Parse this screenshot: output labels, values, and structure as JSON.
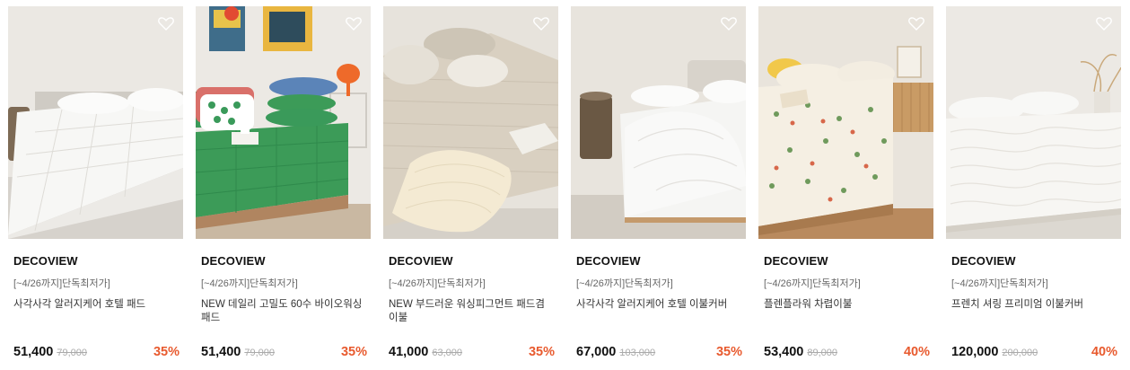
{
  "products": [
    {
      "brand": "DECOVIEW",
      "promo": "[~4/26까지]단독최저가]",
      "name": "사각사각 알러지케어 호텔 패드",
      "price": "51,400",
      "original_price": "79,000",
      "discount": "35%",
      "image": "white quilted mattress pad on bed"
    },
    {
      "brand": "DECOVIEW",
      "promo": "[~4/26까지]단독최저가]",
      "name": "NEW 데일리 고밀도 60수 바이오워싱 패드",
      "price": "51,400",
      "original_price": "79,000",
      "discount": "35%",
      "image": "green quilted pad with pillows and lamp"
    },
    {
      "brand": "DECOVIEW",
      "promo": "[~4/26까지]단독최저가]",
      "name": "NEW 부드러운 워싱피그먼트 패드겸 이불",
      "price": "41,000",
      "original_price": "63,000",
      "discount": "35%",
      "image": "beige quilted pad with knit blanket"
    },
    {
      "brand": "DECOVIEW",
      "promo": "[~4/26까지]단독최저가]",
      "name": "사각사각 알러지케어 호텔 이불커버",
      "price": "67,000",
      "original_price": "103,000",
      "discount": "35%",
      "image": "white duvet cover on bed"
    },
    {
      "brand": "DECOVIEW",
      "promo": "[~4/26까지]단독최저가]",
      "name": "플렌플라워 차렵이불",
      "price": "53,400",
      "original_price": "89,000",
      "discount": "40%",
      "image": "floral print comforter"
    },
    {
      "brand": "DECOVIEW",
      "promo": "[~4/26까지]단독최저가]",
      "name": "프렌치 셔링 프리미엄 이불커버",
      "price": "120,000",
      "original_price": "200,000",
      "discount": "40%",
      "image": "white shirred duvet cover"
    }
  ],
  "colors": {
    "discount": "#e85a2e",
    "price": "#111111",
    "original_price": "#aaaaaa"
  },
  "icons": {
    "wishlist": "heart-outline-icon"
  }
}
